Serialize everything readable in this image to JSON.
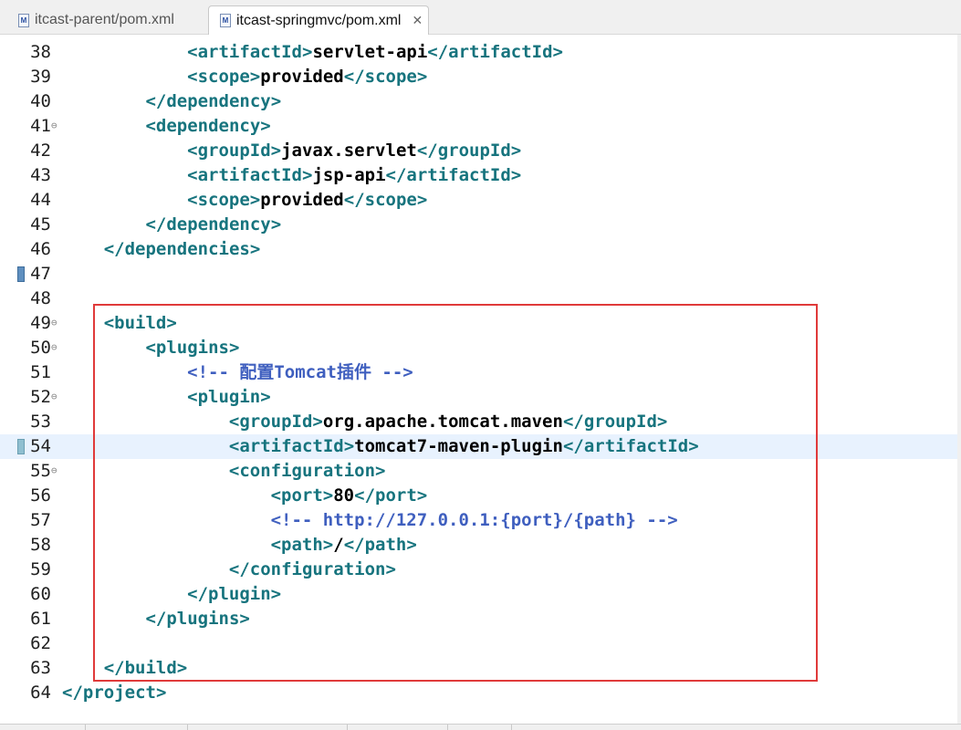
{
  "tabs": [
    {
      "label": "itcast-parent/pom.xml",
      "active": false
    },
    {
      "label": "itcast-springmvc/pom.xml",
      "active": true,
      "close": "✕"
    }
  ],
  "lines": [
    {
      "num": "38",
      "indent": 2,
      "parts": [
        [
          "tag",
          "<artifactId>"
        ],
        [
          "txt",
          "servlet-api"
        ],
        [
          "tag",
          "</artifactId>"
        ]
      ]
    },
    {
      "num": "39",
      "indent": 2,
      "parts": [
        [
          "tag",
          "<scope>"
        ],
        [
          "txt",
          "provided"
        ],
        [
          "tag",
          "</scope>"
        ]
      ]
    },
    {
      "num": "40",
      "indent": 1,
      "parts": [
        [
          "tag",
          "</dependency>"
        ]
      ]
    },
    {
      "num": "41",
      "indent": 1,
      "fold": true,
      "parts": [
        [
          "tag",
          "<dependency>"
        ]
      ]
    },
    {
      "num": "42",
      "indent": 2,
      "parts": [
        [
          "tag",
          "<groupId>"
        ],
        [
          "txt",
          "javax.servlet"
        ],
        [
          "tag",
          "</groupId>"
        ]
      ]
    },
    {
      "num": "43",
      "indent": 2,
      "parts": [
        [
          "tag",
          "<artifactId>"
        ],
        [
          "txt",
          "jsp-api"
        ],
        [
          "tag",
          "</artifactId>"
        ]
      ]
    },
    {
      "num": "44",
      "indent": 2,
      "parts": [
        [
          "tag",
          "<scope>"
        ],
        [
          "txt",
          "provided"
        ],
        [
          "tag",
          "</scope>"
        ]
      ]
    },
    {
      "num": "45",
      "indent": 1,
      "parts": [
        [
          "tag",
          "</dependency>"
        ]
      ]
    },
    {
      "num": "46",
      "indent": 0,
      "parts": [
        [
          "tag",
          "</dependencies>"
        ]
      ]
    },
    {
      "num": "47",
      "indent": 0,
      "marker": true,
      "parts": []
    },
    {
      "num": "48",
      "indent": 0,
      "parts": []
    },
    {
      "num": "49",
      "indent": 0,
      "fold": true,
      "parts": [
        [
          "tag",
          "<build>"
        ]
      ]
    },
    {
      "num": "50",
      "indent": 1,
      "fold": true,
      "parts": [
        [
          "tag",
          "<plugins>"
        ]
      ]
    },
    {
      "num": "51",
      "indent": 2,
      "parts": [
        [
          "com",
          "<!-- 配置Tomcat插件 -->"
        ]
      ]
    },
    {
      "num": "52",
      "indent": 2,
      "fold": true,
      "parts": [
        [
          "tag",
          "<plugin>"
        ]
      ]
    },
    {
      "num": "53",
      "indent": 3,
      "parts": [
        [
          "tag",
          "<groupId>"
        ],
        [
          "txt",
          "org.apache.tomcat.maven"
        ],
        [
          "tag",
          "</groupId>"
        ]
      ]
    },
    {
      "num": "54",
      "indent": 3,
      "current": true,
      "parts": [
        [
          "tag",
          "<artifactId>"
        ],
        [
          "txt",
          "tomcat7-maven-plugin"
        ],
        [
          "tag",
          "</artifactId>"
        ]
      ]
    },
    {
      "num": "55",
      "indent": 3,
      "fold": true,
      "parts": [
        [
          "tag",
          "<configuration>"
        ]
      ]
    },
    {
      "num": "56",
      "indent": 4,
      "parts": [
        [
          "tag",
          "<port>"
        ],
        [
          "txt",
          "80"
        ],
        [
          "tag",
          "</port>"
        ]
      ]
    },
    {
      "num": "57",
      "indent": 4,
      "parts": [
        [
          "com",
          "<!-- http://127.0.0.1:{port}/{path} -->"
        ]
      ]
    },
    {
      "num": "58",
      "indent": 4,
      "parts": [
        [
          "tag",
          "<path>"
        ],
        [
          "txt",
          "/"
        ],
        [
          "tag",
          "</path>"
        ]
      ]
    },
    {
      "num": "59",
      "indent": 3,
      "parts": [
        [
          "tag",
          "</configuration>"
        ]
      ]
    },
    {
      "num": "60",
      "indent": 2,
      "parts": [
        [
          "tag",
          "</plugin>"
        ]
      ]
    },
    {
      "num": "61",
      "indent": 1,
      "parts": [
        [
          "tag",
          "</plugins>"
        ]
      ]
    },
    {
      "num": "62",
      "indent": 0,
      "parts": []
    },
    {
      "num": "63",
      "indent": 0,
      "parts": [
        [
          "tag",
          "</build>"
        ]
      ]
    },
    {
      "num": "64",
      "indent": -1,
      "parts": [
        [
          "tag",
          "</project>"
        ]
      ]
    }
  ],
  "colors": {
    "tag": "#17747e",
    "text": "#000000",
    "comment": "#3f5fbf",
    "highlight_box": "#e03a3a",
    "current_line": "#e8f2fe"
  }
}
